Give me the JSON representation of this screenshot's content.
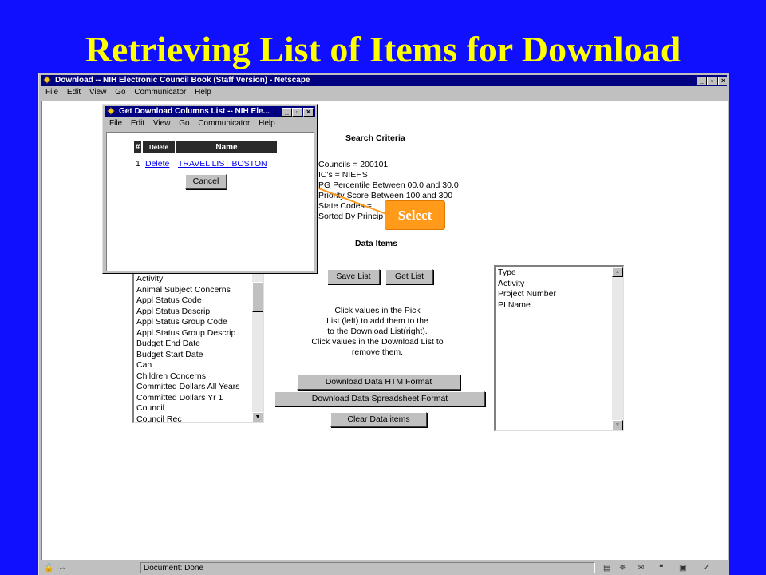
{
  "slide": {
    "title": "Retrieving List of Items for Download"
  },
  "main_window": {
    "title": "Download -- NIH Electronic Council Book (Staff Version) - Netscape",
    "menu": [
      "File",
      "Edit",
      "View",
      "Go",
      "Communicator",
      "Help"
    ],
    "status_text": "Document: Done"
  },
  "search_criteria": {
    "heading": "Search Criteria",
    "lines": [
      "Councils = 200101",
      "IC's = NIEHS",
      "PG Percentile Between 00.0 and 30.0",
      "Priority Score Between 100 and 300",
      "State Codes =",
      "Sorted By Princip"
    ]
  },
  "data_items": {
    "heading": "Data Items",
    "save_label": "Save List",
    "get_label": "Get List",
    "instructions": [
      "Click values in the Pick",
      "List (left) to add them to the",
      "to the Download List(right).",
      "Click values in the Download List to",
      "remove them."
    ],
    "download_htm_label": "Download Data HTM Format",
    "download_spreadsheet_label": "Download Data Spreadsheet Format",
    "clear_label": "Clear Data items"
  },
  "pick_list": {
    "items": [
      "Activity",
      "Animal Subject Concerns",
      "Appl Status Code",
      "Appl Status Descrip",
      "Appl Status Group Code",
      "Appl Status Group Descrip",
      "Budget End Date",
      "Budget Start Date",
      "Can",
      "Children Concerns",
      "Committed Dollars All Years",
      "Committed Dollars Yr 1",
      "Council",
      "Council Rec"
    ]
  },
  "download_list": {
    "items": [
      "Type",
      "Activity",
      "Project Number",
      "PI Name"
    ]
  },
  "popup": {
    "title": "Get Download Columns List -- NIH Ele...",
    "menu": [
      "File",
      "Edit",
      "View",
      "Go",
      "Communicator",
      "Help"
    ],
    "table_headers": {
      "num": "#",
      "delete": "Delete",
      "name": "Name"
    },
    "row": {
      "num": "1",
      "delete": "Delete",
      "name": "TRAVEL LIST BOSTON"
    },
    "cancel_label": "Cancel"
  },
  "callout": {
    "label": "Select"
  },
  "colors": {
    "slide_background": "#1010ff",
    "title_color": "#ffff00",
    "callout": "#ff9a1a",
    "link": "#0000ee"
  },
  "icons": [
    "netscape-icon",
    "minimize-icon",
    "maximize-icon",
    "close-icon"
  ]
}
